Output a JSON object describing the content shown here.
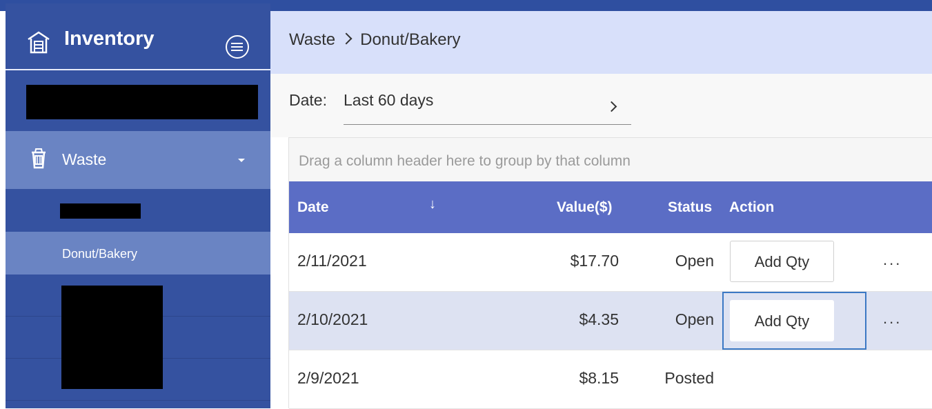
{
  "sidebar": {
    "title": "Inventory",
    "items": [
      {
        "label": "Waste"
      },
      {
        "label": "Donut/Bakery"
      }
    ]
  },
  "breadcrumb": {
    "parent": "Waste",
    "current": "Donut/Bakery"
  },
  "filter": {
    "label": "Date:",
    "value": "Last 60 days"
  },
  "grid": {
    "group_hint": "Drag a column header here to group by that column",
    "columns": [
      "Date",
      "Value($)",
      "Status",
      "Action"
    ],
    "sort_indicator": "↓",
    "rows": [
      {
        "date": "2/11/2021",
        "value": "$17.70",
        "status": "Open",
        "action": "Add Qty",
        "more": "..."
      },
      {
        "date": "2/10/2021",
        "value": "$4.35",
        "status": "Open",
        "action": "Add Qty",
        "more": "..."
      },
      {
        "date": "2/9/2021",
        "value": "$8.15",
        "status": "Posted"
      }
    ]
  },
  "colors": {
    "sidebar": "#3552a0",
    "sidebar_selected": "#6a84c3",
    "breadcrumb_bar": "#d8e0fa",
    "table_header": "#5b6dc5",
    "selected_row": "#dde2f2",
    "focus_border": "#3b78c4"
  }
}
